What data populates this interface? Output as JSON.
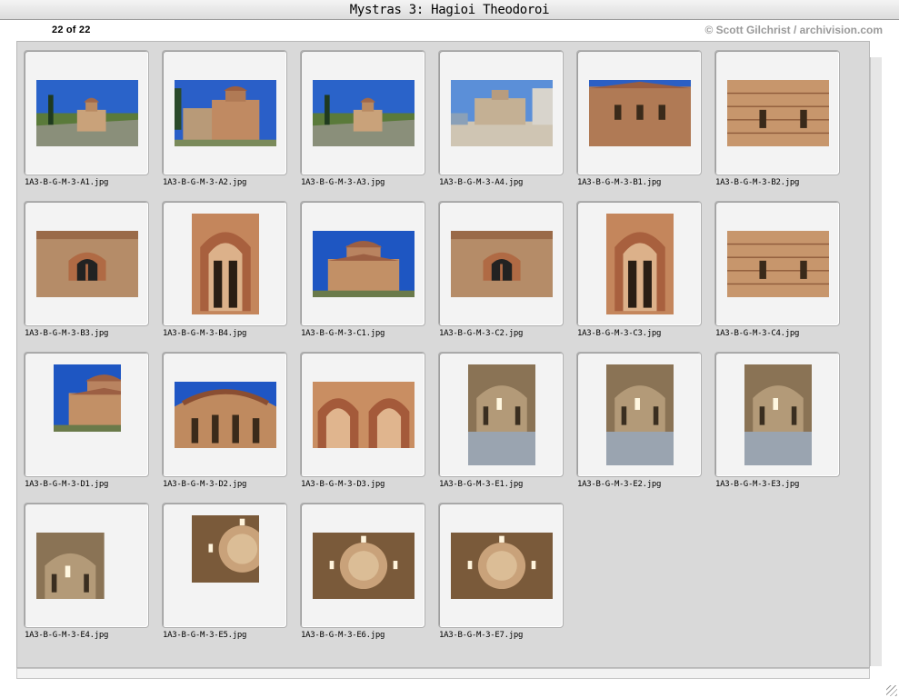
{
  "window": {
    "title": "Mystras 3: Hagioi Theodoroi"
  },
  "header": {
    "count": "22 of 22",
    "credit": "© Scott Gilchrist / archivision.com"
  },
  "thumbnails": [
    {
      "file": "1A3-B-G-M-3-A1.jpg",
      "scene": "church-landscape",
      "orientation": "landscape"
    },
    {
      "file": "1A3-B-G-M-3-A2.jpg",
      "scene": "church-wall",
      "orientation": "landscape"
    },
    {
      "file": "1A3-B-G-M-3-A3.jpg",
      "scene": "church-landscape",
      "orientation": "landscape"
    },
    {
      "file": "1A3-B-G-M-3-A4.jpg",
      "scene": "courtyard",
      "orientation": "landscape"
    },
    {
      "file": "1A3-B-G-M-3-B1.jpg",
      "scene": "facade",
      "orientation": "landscape"
    },
    {
      "file": "1A3-B-G-M-3-B2.jpg",
      "scene": "brick-wall",
      "orientation": "landscape"
    },
    {
      "file": "1A3-B-G-M-3-B3.jpg",
      "scene": "window-wall",
      "orientation": "landscape"
    },
    {
      "file": "1A3-B-G-M-3-B4.jpg",
      "scene": "arch-window",
      "orientation": "portrait"
    },
    {
      "file": "1A3-B-G-M-3-C1.jpg",
      "scene": "church-sky",
      "orientation": "landscape"
    },
    {
      "file": "1A3-B-G-M-3-C2.jpg",
      "scene": "window-wall",
      "orientation": "landscape"
    },
    {
      "file": "1A3-B-G-M-3-C3.jpg",
      "scene": "arch-window",
      "orientation": "portrait"
    },
    {
      "file": "1A3-B-G-M-3-C4.jpg",
      "scene": "brick-wall",
      "orientation": "landscape"
    },
    {
      "file": "1A3-B-G-M-3-D1.jpg",
      "scene": "church-sky",
      "orientation": "portrait"
    },
    {
      "file": "1A3-B-G-M-3-D2.jpg",
      "scene": "apse",
      "orientation": "landscape"
    },
    {
      "file": "1A3-B-G-M-3-D3.jpg",
      "scene": "arches",
      "orientation": "landscape"
    },
    {
      "file": "1A3-B-G-M-3-E1.jpg",
      "scene": "interior",
      "orientation": "portrait"
    },
    {
      "file": "1A3-B-G-M-3-E2.jpg",
      "scene": "interior",
      "orientation": "portrait"
    },
    {
      "file": "1A3-B-G-M-3-E3.jpg",
      "scene": "interior",
      "orientation": "portrait"
    },
    {
      "file": "1A3-B-G-M-3-E4.jpg",
      "scene": "interior",
      "orientation": "landscape"
    },
    {
      "file": "1A3-B-G-M-3-E5.jpg",
      "scene": "dome",
      "orientation": "portrait"
    },
    {
      "file": "1A3-B-G-M-3-E6.jpg",
      "scene": "dome",
      "orientation": "landscape"
    },
    {
      "file": "1A3-B-G-M-3-E7.jpg",
      "scene": "dome",
      "orientation": "landscape"
    }
  ],
  "colors": {
    "panel": "#d9d9d9",
    "slide": "#f3f3f3",
    "credit": "#9a9a9a",
    "sky": "#1f5fc8",
    "brick": "#b9825a"
  }
}
